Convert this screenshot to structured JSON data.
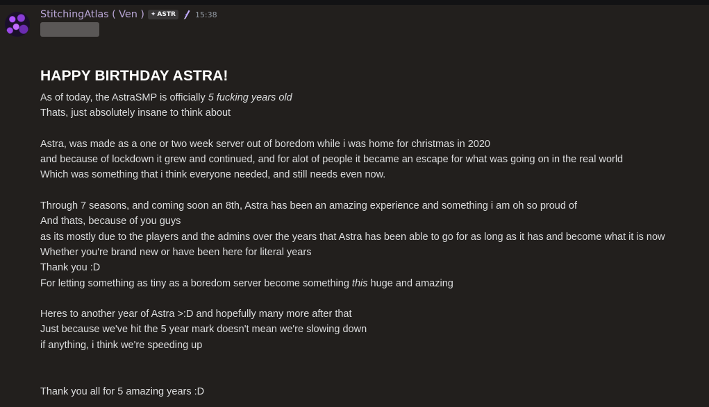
{
  "message": {
    "author": "StitchingAtlas ( Ven )",
    "tag": {
      "icon": "sparkle-icon",
      "text": "ASTR"
    },
    "badge_icon": "nitro-icon",
    "timestamp": "15:38",
    "title": "HAPPY BIRTHDAY ASTRA!",
    "body": {
      "l1_a": "As of today, the AstraSMP is officially ",
      "l1_b": "5 fucking years old",
      "l2": "Thats, just absolutely insane to think about",
      "l3": "Astra, was made as a one or two week server out of boredom while i was home for christmas in 2020",
      "l4": "and because of lockdown it grew and continued, and for alot of people it became an escape for what was going on in the real world",
      "l5": "Which was something that i think everyone needed, and still needs even now.",
      "l6": "Through 7 seasons, and coming soon an 8th, Astra has been an amazing experience and something i am oh so proud of",
      "l7": "And thats, because of you guys",
      "l8": "as its mostly due to the players and the admins over the years that Astra has been able to go for as long as it has and become what it is now",
      "l9": "Whether you're brand new or have been here for literal years",
      "l10": "Thank you :D",
      "l11_a": "For letting something as tiny as a boredom server become something ",
      "l11_b": "this",
      "l11_c": " huge and amazing",
      "l12": "Heres to another year of Astra >:D and hopefully many more after that",
      "l13": "Just because we've hit the 5 year mark doesn't mean we're slowing down",
      "l14": "if anything, i think we're speeding up",
      "l15": "Thank you all for 5 amazing years :D"
    }
  },
  "colors": {
    "background": "#221f1d",
    "username": "#b9a6d6",
    "text": "#dcddde",
    "title": "#ffffff",
    "timestamp": "#949ba4"
  }
}
